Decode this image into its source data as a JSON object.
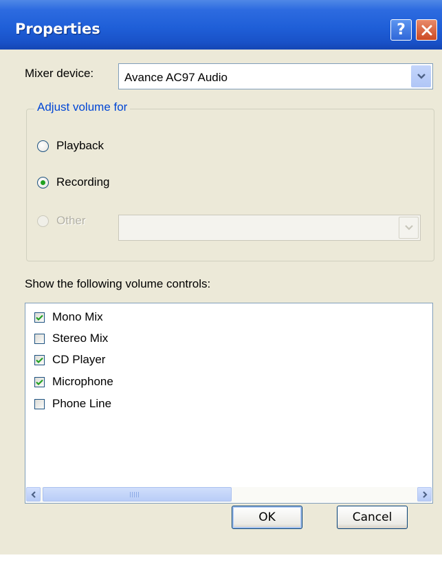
{
  "dialog": {
    "title": "Properties",
    "help_glyph": "?"
  },
  "mixer": {
    "label": "Mixer device:",
    "value": "Avance AC97 Audio"
  },
  "adjust": {
    "legend": "Adjust volume for",
    "options": [
      {
        "label": "Playback",
        "checked": false,
        "enabled": true
      },
      {
        "label": "Recording",
        "checked": true,
        "enabled": true
      },
      {
        "label": "Other",
        "checked": false,
        "enabled": false
      }
    ],
    "other_combo_value": ""
  },
  "controls": {
    "label": "Show the following volume controls:",
    "items": [
      {
        "label": "Mono Mix",
        "checked": true
      },
      {
        "label": "Stereo Mix",
        "checked": false
      },
      {
        "label": "CD Player",
        "checked": true
      },
      {
        "label": "Microphone",
        "checked": true
      },
      {
        "label": "Phone Line",
        "checked": false
      }
    ]
  },
  "buttons": {
    "ok": "OK",
    "cancel": "Cancel"
  },
  "colors": {
    "titlebar": "#1f5fd8",
    "groupbox_legend": "#0046d5",
    "check": "#21a121",
    "dialog_bg": "#ece9d8"
  }
}
